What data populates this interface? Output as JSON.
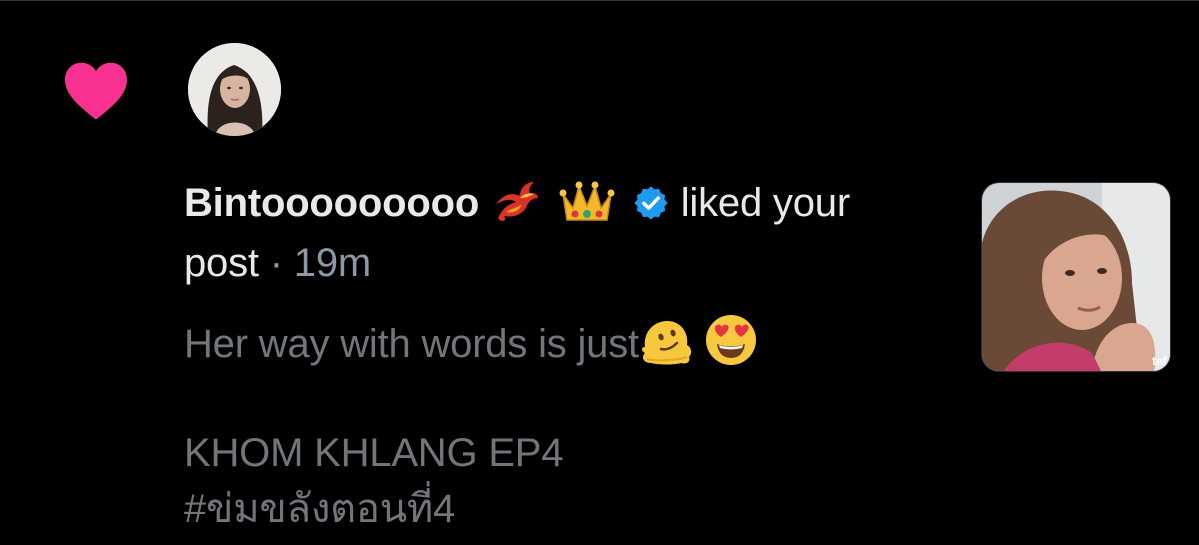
{
  "notification": {
    "type": "like",
    "icons": {
      "action": "heart-icon",
      "verified": "verified-badge-icon",
      "emoji_1": "phoenix-emoji-icon",
      "emoji_2": "crown-emoji-icon",
      "emoji_3": "melting-face-emoji-icon",
      "emoji_4": "heart-eyes-emoji-icon"
    },
    "colors": {
      "heart": "#f91880",
      "verified": "#1d9bf0",
      "background": "#000000",
      "primary_text": "#e7e9ea",
      "secondary_text": "#71767b"
    },
    "username": "Bintooooooooo",
    "action_text": "liked your",
    "action_text_cont": "post",
    "separator": "·",
    "time": "19m",
    "post": {
      "line1": "Her way with words is just",
      "line2": "KHOM KHLANG EP4",
      "line3": "#ข่มขลังตอนที่4"
    }
  }
}
